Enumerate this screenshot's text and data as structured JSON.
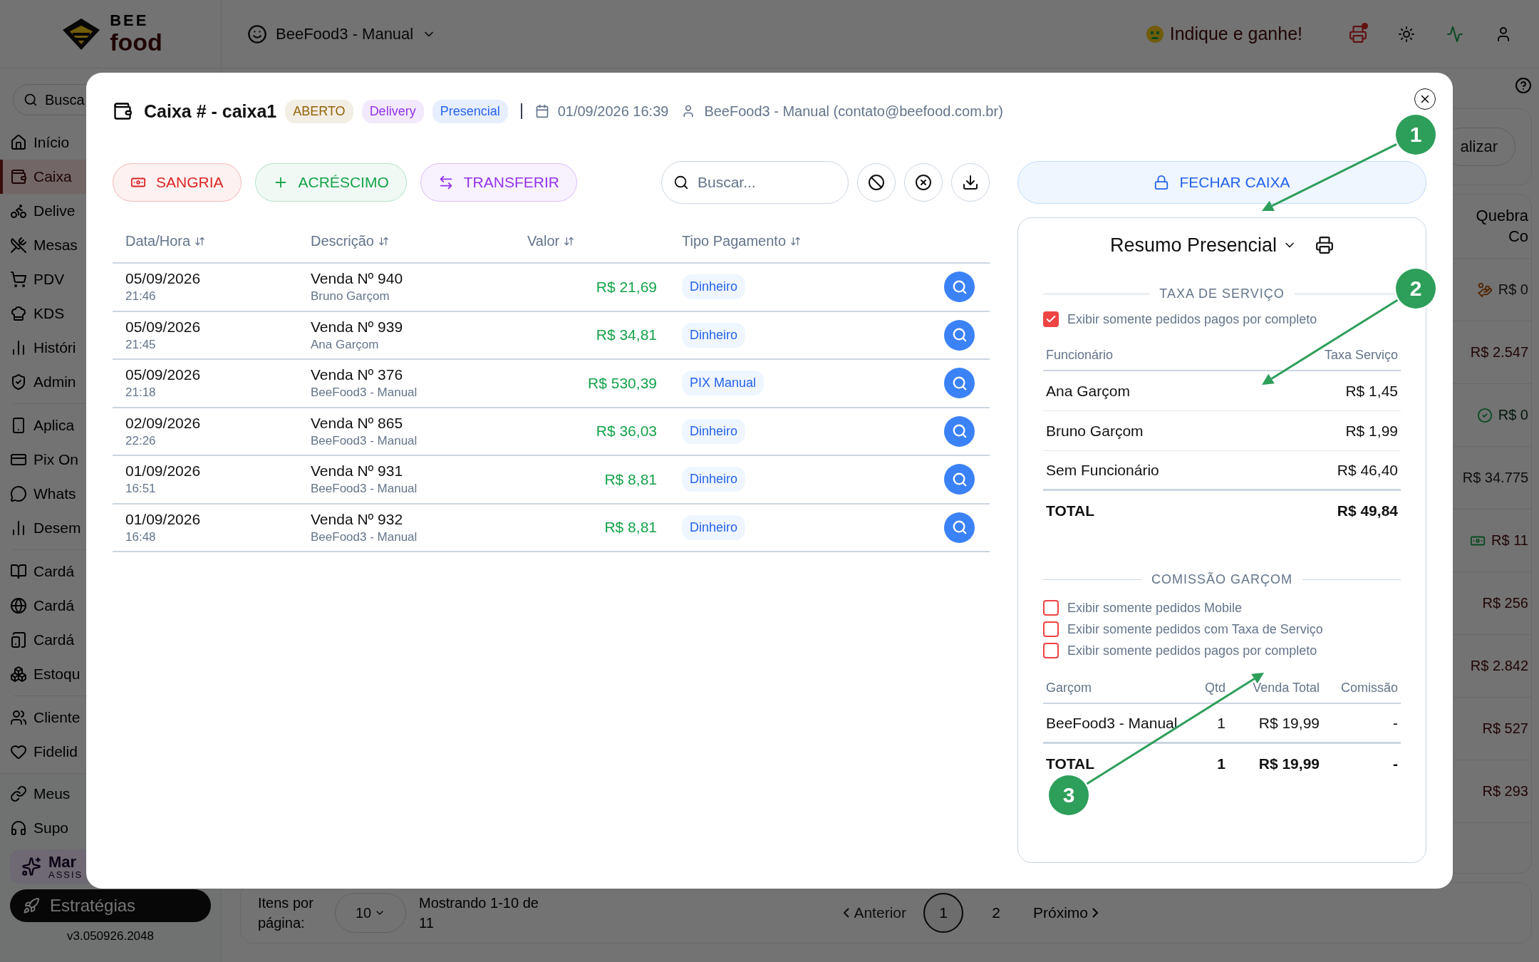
{
  "sidebar": {
    "logo": {
      "top": "BEE",
      "bottom": "food"
    },
    "search_placeholder": "Busca",
    "groups": [
      [
        {
          "label": "Início",
          "selected": false
        },
        {
          "label": "Caixa",
          "selected": true
        },
        {
          "label": "Delive",
          "selected": false
        },
        {
          "label": "Mesas",
          "selected": false
        },
        {
          "label": "PDV",
          "selected": false
        },
        {
          "label": "KDS",
          "selected": false
        },
        {
          "label": "Históri",
          "selected": false
        },
        {
          "label": "Admin",
          "selected": false
        }
      ],
      [
        {
          "label": "Aplica",
          "selected": false
        },
        {
          "label": "Pix On",
          "selected": false
        },
        {
          "label": "Whats",
          "selected": false
        },
        {
          "label": "Desem",
          "selected": false
        }
      ],
      [
        {
          "label": "Cardá",
          "selected": false
        },
        {
          "label": "Cardá",
          "selected": false
        },
        {
          "label": "Cardá",
          "selected": false
        },
        {
          "label": "Estoqu",
          "selected": false
        }
      ],
      [
        {
          "label": "Cliente",
          "selected": false
        },
        {
          "label": "Fidelid",
          "selected": false
        }
      ]
    ],
    "bottom_items": [
      "Meus",
      "Supo"
    ],
    "promo": {
      "title": "Mar",
      "subtitle": "ASSIS"
    },
    "strategy_button": "Estratégias",
    "version": "v3.050926.2048"
  },
  "topbar": {
    "store": "BeeFood3 - Manual",
    "referral": "Indique e ganhe!"
  },
  "page": {
    "filter_button": "alizar",
    "column_header": [
      "Quebra",
      "Co"
    ],
    "rows": [
      {
        "value": "R$ 0",
        "kind": "bag"
      },
      {
        "value": "R$ 2.547",
        "kind": "loss"
      },
      {
        "value": "R$ 0",
        "kind": "check"
      },
      {
        "value": "R$ 34.775",
        "kind": "plain"
      },
      {
        "value": "R$ 11",
        "kind": "money"
      },
      {
        "value": "R$ 256",
        "kind": "loss"
      },
      {
        "value": "R$ 2.842",
        "kind": "loss"
      },
      {
        "value": "R$ 527",
        "kind": "loss"
      },
      {
        "value": "R$ 293",
        "kind": "loss"
      }
    ],
    "pagination": {
      "per_page_label": "Itens por página:",
      "per_page": "10",
      "showing": "Mostrando 1-10 de 11",
      "previous": "Anterior",
      "pages": [
        {
          "label": "1",
          "selected": true
        },
        {
          "label": "2",
          "selected": false
        }
      ],
      "next": "Próximo"
    }
  },
  "modal": {
    "title": "Caixa # - caixa1",
    "badges": [
      {
        "label": "ABERTO",
        "color": "#92620a"
      },
      {
        "label": "Delivery",
        "color": "#9333ea"
      },
      {
        "label": "Presencial",
        "color": "#2563eb"
      }
    ],
    "opened_at": "01/09/2026 16:39",
    "user": "BeeFood3 - Manual (contato@beefood.com.br)",
    "actions": [
      {
        "label": "SANGRIA",
        "color": "#dc2626"
      },
      {
        "label": "ACRÉSCIMO",
        "color": "#16a34a"
      },
      {
        "label": "TRANSFERIR",
        "color": "#9333ea"
      }
    ],
    "search_placeholder": "Buscar...",
    "columns": [
      "Data/Hora",
      "Descrição",
      "Valor",
      "Tipo Pagamento"
    ],
    "rows": [
      {
        "date": "05/09/2026",
        "time": "21:46",
        "description": "Venda Nº 940",
        "by": "Bruno Garçom",
        "value": "R$ 21,69",
        "payment": "Dinheiro"
      },
      {
        "date": "05/09/2026",
        "time": "21:45",
        "description": "Venda Nº 939",
        "by": "Ana Garçom",
        "value": "R$ 34,81",
        "payment": "Dinheiro"
      },
      {
        "date": "05/09/2026",
        "time": "21:18",
        "description": "Venda Nº 376",
        "by": "BeeFood3 - Manual",
        "value": "R$ 530,39",
        "payment": "PIX Manual"
      },
      {
        "date": "02/09/2026",
        "time": "22:26",
        "description": "Venda Nº 865",
        "by": "BeeFood3 - Manual",
        "value": "R$ 36,03",
        "payment": "Dinheiro"
      },
      {
        "date": "01/09/2026",
        "time": "16:51",
        "description": "Venda Nº 931",
        "by": "BeeFood3 - Manual",
        "value": "R$ 8,81",
        "payment": "Dinheiro"
      },
      {
        "date": "01/09/2026",
        "time": "16:48",
        "description": "Venda Nº 932",
        "by": "BeeFood3 - Manual",
        "value": "R$ 8,81",
        "payment": "Dinheiro"
      }
    ],
    "close_button": "FECHAR CAIXA",
    "summary": {
      "title": "Resumo Presencial",
      "sections": [
        {
          "title": "TAXA DE SERVIÇO",
          "filters": [
            {
              "label": "Exibir somente pedidos pagos por completo",
              "checked": true
            }
          ],
          "columns": [
            "Funcionário",
            "Taxa Serviço"
          ],
          "rows": [
            [
              "Ana Garçom",
              "R$ 1,45"
            ],
            [
              "Bruno Garçom",
              "R$ 1,99"
            ],
            [
              "Sem Funcionário",
              "R$ 46,40"
            ]
          ],
          "total": [
            "TOTAL",
            "R$ 49,84"
          ]
        },
        {
          "title": "COMISSÃO GARÇOM",
          "filters": [
            {
              "label": "Exibir somente pedidos Mobile",
              "checked": false
            },
            {
              "label": "Exibir somente pedidos com Taxa de Serviço",
              "checked": false
            },
            {
              "label": "Exibir somente pedidos pagos por completo",
              "checked": false
            }
          ],
          "columns": [
            "Garçom",
            "Qtd",
            "Venda Total",
            "Comissão"
          ],
          "rows": [
            [
              "BeeFood3 - Manual",
              "1",
              "R$ 19,99",
              "-"
            ]
          ],
          "total": [
            "TOTAL",
            "1",
            "R$ 19,99",
            "-"
          ]
        }
      ]
    }
  },
  "annotations": [
    {
      "label": "1"
    },
    {
      "label": "2"
    },
    {
      "label": "3"
    }
  ]
}
